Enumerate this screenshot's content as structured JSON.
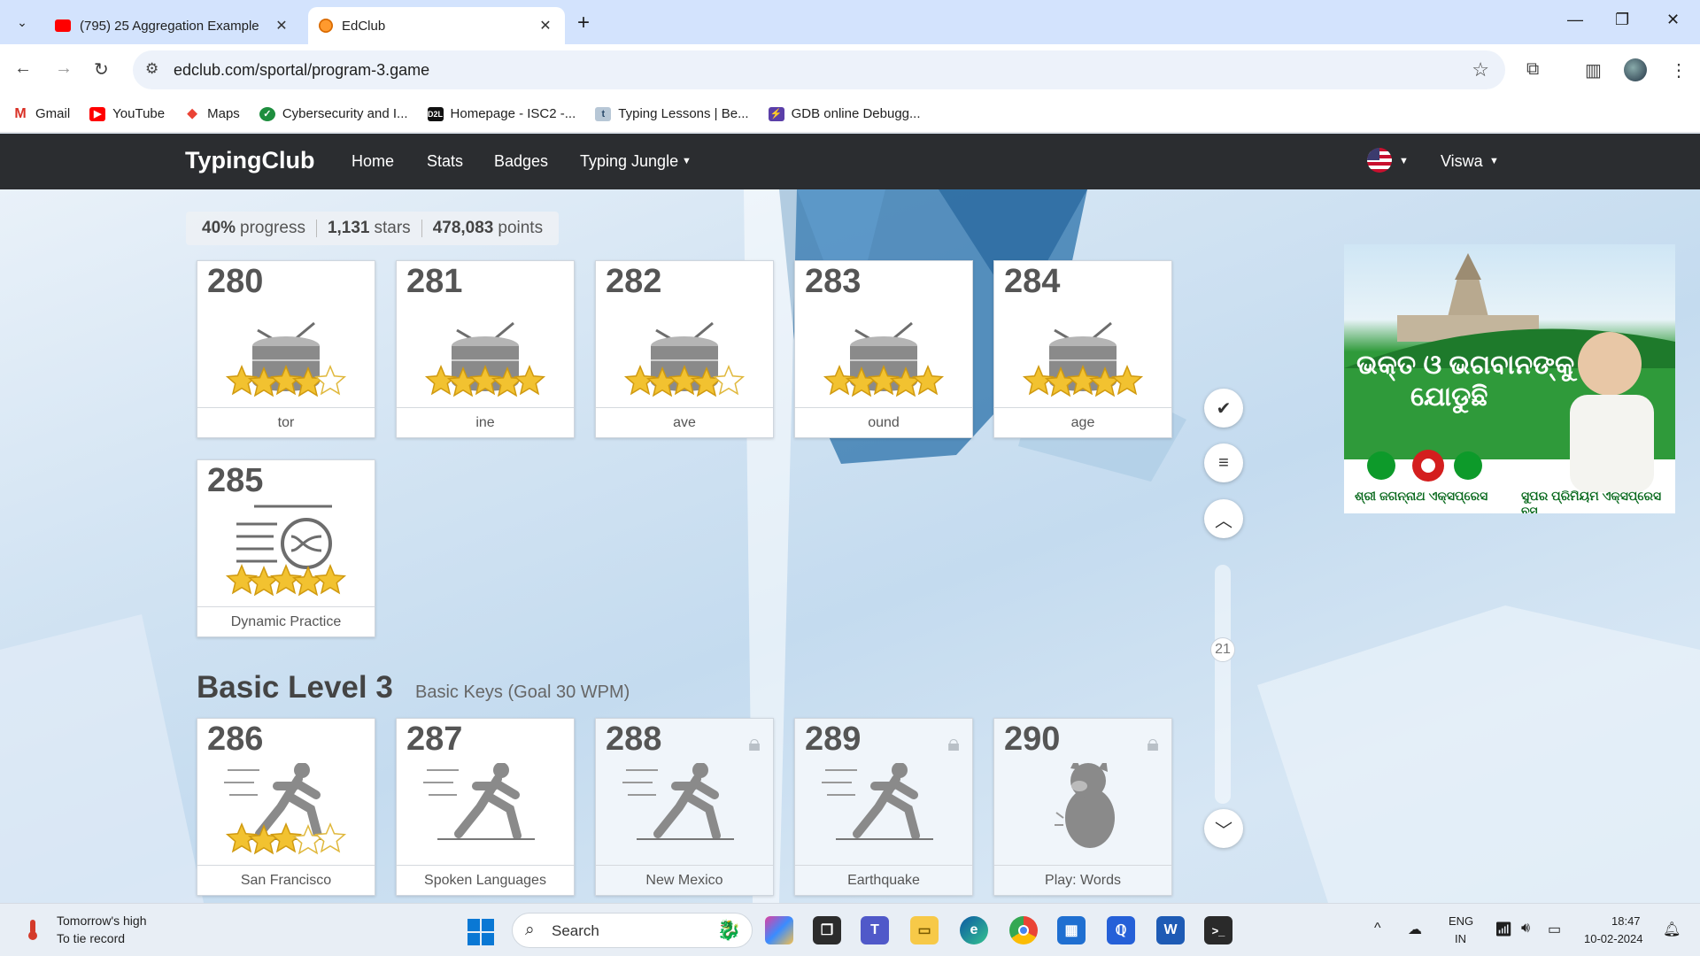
{
  "browser": {
    "tabs": [
      {
        "title": "(795) 25 Aggregation Example",
        "active": false
      },
      {
        "title": "EdClub",
        "active": true
      }
    ],
    "url": "edclub.com/sportal/program-3.game",
    "bookmarks": [
      "Gmail",
      "YouTube",
      "Maps",
      "Cybersecurity and I...",
      "Homepage - ISC2 -...",
      "Typing Lessons | Be...",
      "GDB online Debugg..."
    ]
  },
  "site": {
    "brand": "TypingClub",
    "nav": {
      "home": "Home",
      "stats": "Stats",
      "badges": "Badges",
      "jungle": "Typing Jungle"
    },
    "user": "Viswa"
  },
  "progress": {
    "progress_value": "40%",
    "progress_label": "progress",
    "stars_value": "1,131",
    "stars_label": "stars",
    "points_value": "478,083",
    "points_label": "points"
  },
  "lessons_row1": [
    {
      "num": "280",
      "label": "tor",
      "icon": "drum-icon",
      "stars": 4
    },
    {
      "num": "281",
      "label": "ine",
      "icon": "drum-icon",
      "stars": 5
    },
    {
      "num": "282",
      "label": "ave",
      "icon": "drum-icon",
      "stars": 4
    },
    {
      "num": "283",
      "label": "ound",
      "icon": "drum-icon",
      "stars": 5
    },
    {
      "num": "284",
      "label": "age",
      "icon": "drum-icon",
      "stars": 5
    }
  ],
  "lessons_row2": [
    {
      "num": "285",
      "label": "Dynamic Practice",
      "icon": "shuffle-icon",
      "stars": 5
    }
  ],
  "section": {
    "title": "Basic Level 3",
    "subtitle": "Basic Keys (Goal 30 WPM)"
  },
  "lessons_row3": [
    {
      "num": "286",
      "label": "San Francisco",
      "icon": "runner-icon",
      "stars": 3,
      "locked": false
    },
    {
      "num": "287",
      "label": "Spoken Languages",
      "icon": "runner-icon",
      "stars": 0,
      "locked": false
    },
    {
      "num": "288",
      "label": "New Mexico",
      "icon": "runner-icon",
      "stars": 0,
      "locked": true
    },
    {
      "num": "289",
      "label": "Earthquake",
      "icon": "runner-icon",
      "stars": 0,
      "locked": true
    },
    {
      "num": "290",
      "label": "Play: Words",
      "icon": "creature-icon",
      "stars": 0,
      "locked": true
    }
  ],
  "scroll": {
    "indicator": "21"
  },
  "ad": {
    "line1": "ଭକ୍ତ ଓ ଭଗବାନଙ୍କୁ",
    "line2": "ଯୋଡୁଛି",
    "foot1": "ଶ୍ରୀ ଜଗନ୍ନାଥ ଏକ୍ସପ୍ରେସ",
    "foot2": "ସୁପର ପ୍ରିମିୟମ ଏକ୍ସପ୍ରେସ ବସ"
  },
  "taskbar": {
    "weather_line1": "Tomorrow's high",
    "weather_line2": "To tie record",
    "search": "Search",
    "lang_line1": "ENG",
    "lang_line2": "IN",
    "time": "18:47",
    "date": "10-02-2024"
  },
  "colors": {
    "star": "#f2c230",
    "nav_bg": "#2b2d30",
    "accent": "#0a78d4"
  }
}
